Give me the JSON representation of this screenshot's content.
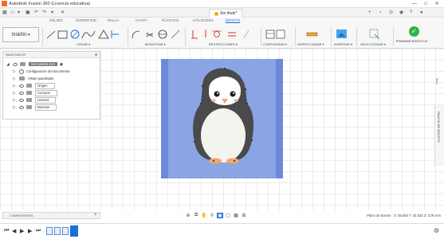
{
  "window": {
    "title": "Autodesk Fusion 360 (Licencia educativa)",
    "controls": [
      "—",
      "□",
      "✕"
    ]
  },
  "document_tab": {
    "label": "Sin título*"
  },
  "ribbon_tabs": [
    "SÓLIDO",
    "SUPERFICIE",
    "MALLA",
    "CHAPA",
    "PLÁSTICO",
    "UTILIDADES",
    "BOCETO"
  ],
  "active_tab_index": 6,
  "ribbon": {
    "workspace_button": "DISEÑO ▾",
    "groups": {
      "create": "CREAR ▾",
      "modify": "MODIFICAR ▾",
      "constraints": "RESTRICCIONES ▾",
      "configure": "CONFIGURAR ▾",
      "inspect": "INSPECCIONAR ▾",
      "insert": "INSERTAR ▾",
      "select": "SELECCIONAR ▾",
      "finish": "TERMINAR BOCETO ▾"
    }
  },
  "browser": {
    "header": "NAVEGADOR",
    "root": "Sin nombre (v1)",
    "items": [
      {
        "label": "Configuración del documento",
        "icon": "gear-icon"
      },
      {
        "label": "Vistas guardadas",
        "icon": "folder-icon"
      },
      {
        "label": "Origen",
        "icon": "folder-icon"
      },
      {
        "label": "Cuerpos",
        "icon": "folder-icon"
      },
      {
        "label": "Lienzos",
        "icon": "folder-icon"
      },
      {
        "label": "Bocetos",
        "icon": "folder-icon"
      }
    ]
  },
  "comments": {
    "label": "COMENTARIOS"
  },
  "right_panel": {
    "label": "PALETA DE BOCETO"
  },
  "status_bar": {
    "text": "Plano de boceto : X: 55.693 Y: 42.532 Z: 2.00 mm"
  },
  "colors": {
    "accent": "#1a6ed8",
    "finish_check": "#2fb34a",
    "canvas_sheet": "#8aa4e4",
    "penguin_body": "#4a4a4a"
  },
  "timeline": {
    "items": 4
  }
}
